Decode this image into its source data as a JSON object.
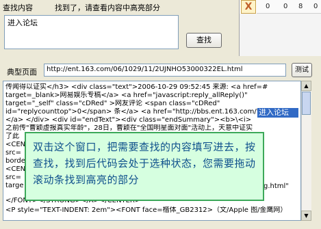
{
  "find_panel": {
    "title": "查找内容",
    "status": "找到了，请查看内容中高亮部分",
    "input_value": "进入论坛",
    "find_button": "查找",
    "close_icon": "X"
  },
  "top_numbers": [
    "0",
    "0",
    "8",
    "0"
  ],
  "url_bar": {
    "label": "典型页面",
    "value": "http://ent.163.com/06/1029/11/2UJNHO53000322EL.html",
    "test_button": "测试"
  },
  "source_lines": [
    "传闻得以证实</h3>       <div class=\"text\">2006-10-29 09:52:45   来源: <a href=#",
    "target=_blank>网易娱乐专稿</a>          <a href=\"javascript:reply_allReply()\"",
    "target=\"_self\" class=\"cDRed\" >网友评论 <span class=\"cDRed\"",
    "id=\"replycounttop\">0</span> 条</a> <a href=\"http://bbs.ent.163.com/\">",
    "</a>         </div>        <div id=\"endText\"><div class=\"endSummary\"><b>\\<i>",
    "之前传\"曹颖虚报真实年龄\"，28日，曹颖在\"全国明星面对面\"活动上，天意中证实",
    "了此",
    "<CEN",
    "src=",
    "borde",
    "<CEN",
    "src=",
    "targe",
    "</FONT></STRONG></A></CENTER>",
    "<P style=\"TEXT-INDENT: 2em\"><FONT face=楷体_GB2312>（文/Apple 图/金鹰网）"
  ],
  "highlight_text": "进入论坛",
  "partial_right_text": "g.html\"",
  "callout_text": "双击这个窗口，把需要查找的内容填写进去，按查找，找到后代码会处于选种状态，您需要拖动滚动条找到高亮的部分"
}
